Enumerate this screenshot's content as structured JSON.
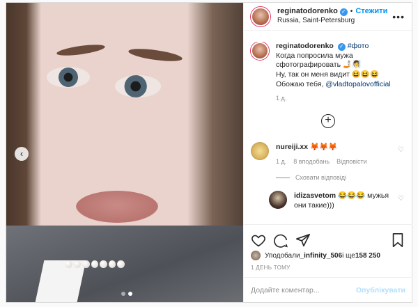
{
  "post": {
    "author": "reginatodorenko",
    "follow_label": "Стежити",
    "separator": "•",
    "location": "Russia, Saint-Petersburg",
    "more_label": "•••"
  },
  "caption": {
    "username": "reginatodorenko",
    "hashtag": "#фото",
    "line1": "Когда попросила мужа",
    "line2": "сфотографировать 🤳🏻🧖‍♀️",
    "line3": "Ну, так он меня видит 😆😆😆",
    "line4_prefix": "Обожаю тебя, ",
    "mention": "@vladtopalovofficial",
    "time": "1 д."
  },
  "load_more_label": "+",
  "comments": [
    {
      "username": "nureiji.xx",
      "text": "🦊🦊🦊",
      "time": "1 д.",
      "likes": "8 вподобань",
      "reply": "Відповісти"
    },
    {
      "username": "idizasvetom",
      "text": "😂😂😂 мужья они такие)))"
    }
  ],
  "hide_replies_label": "Сховати відповіді",
  "likes_summary": {
    "prefix": "Уподобали ",
    "user": "_infinity_506",
    "middle": " і ще ",
    "count": "158 250"
  },
  "date": "1 ДЕНЬ ТОМУ",
  "add_comment": {
    "placeholder": "Додайте коментар...",
    "publish_label": "Опублікувати"
  },
  "carousel": {
    "current": 2,
    "total": 2,
    "prev_label": "‹"
  },
  "colors": {
    "accent": "#0095f6",
    "verified": "#3897f0",
    "muted": "#8e8e8e"
  }
}
